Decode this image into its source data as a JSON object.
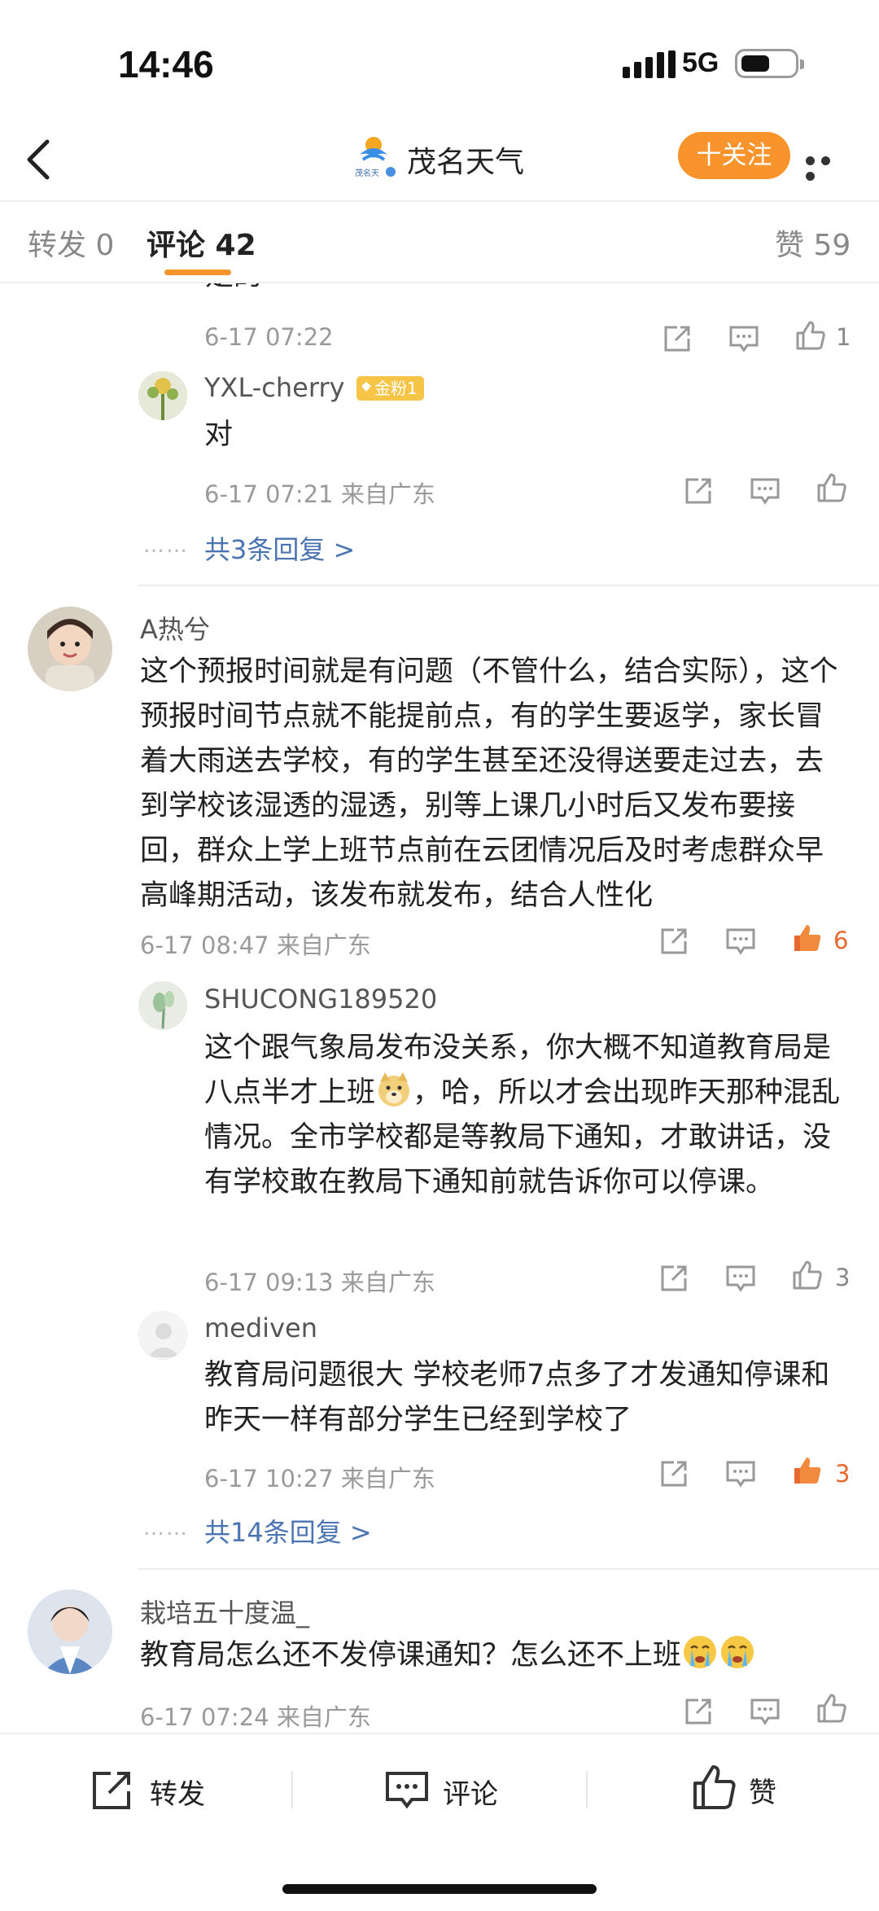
{
  "status": {
    "time": "14:46",
    "network": "5G"
  },
  "nav": {
    "title": "茂名天气",
    "follow_label": "十关注",
    "logo_text": "茂名天"
  },
  "tabs": {
    "repost": "转发 0",
    "comment": "评论 42",
    "like": "赞 59"
  },
  "thread1": {
    "partial_text": "是的",
    "partial_meta": "6-17 07:22",
    "partial_like_count": "1",
    "reply": {
      "name": "YXL-cherry",
      "badge": "金粉1",
      "text": "对",
      "meta": "6-17 07:21 来自广东"
    },
    "more_replies": "共3条回复 >"
  },
  "comment2": {
    "name": "A热兮",
    "text": "这个预报时间就是有问题（不管什么，结合实际），这个预报时间节点就不能提前点，有的学生要返学，家长冒着大雨送去学校，有的学生甚至还没得送要走过去，去到学校该湿透的湿透，别等上课几小时后又发布要接回，群众上学上班节点前在云团情况后及时考虑群众早高峰期活动，该发布就发布，结合人性化",
    "meta": "6-17 08:47 来自广东",
    "like_count": "6",
    "replies": [
      {
        "name": "SHUCONG189520",
        "text_before_emoji": "这个跟气象局发布没关系，你大概不知道教育局是八点半才上班",
        "text_after_emoji": "，哈，所以才会出现昨天那种混乱情况。全市学校都是等教局下通知，才敢讲话，没有学校敢在教局下通知前就告诉你可以停课。",
        "meta": "6-17 09:13 来自广东",
        "like_count": "3"
      },
      {
        "name": "mediven",
        "text": "教育局问题很大 学校老师7点多了才发通知停课和昨天一样有部分学生已经到学校了",
        "meta": "6-17 10:27 来自广东",
        "like_count": "3"
      }
    ],
    "more_replies": "共14条回复 >"
  },
  "comment3": {
    "name": "栽培五十度温_",
    "text": "教育局怎么还不发停课通知？怎么还不上班",
    "meta": "6-17 07:24 来自广东"
  },
  "bottom_bar": {
    "repost": "转发",
    "comment": "评论",
    "like": "赞"
  },
  "colors": {
    "accent": "#f9942d",
    "link": "#4a74b2",
    "like_active": "#e8692f"
  }
}
